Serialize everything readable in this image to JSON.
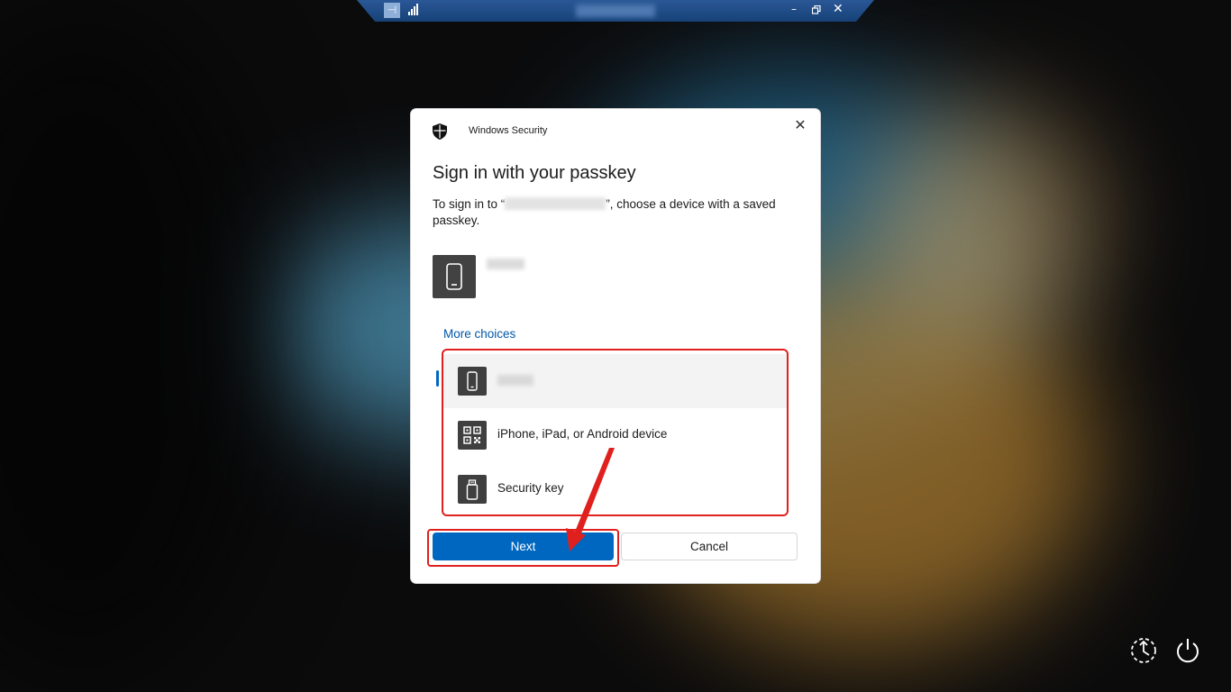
{
  "remote_bar": {
    "pin_icon": "pin-icon",
    "signal_icon": "signal-bars-icon",
    "controls": [
      "minimize-icon",
      "restore-icon",
      "close-icon"
    ]
  },
  "dialog": {
    "app_name": "Windows Security",
    "title": "Sign in with your passkey",
    "description_before": "To sign in to “",
    "description_after": "”, choose a device with a saved passkey.",
    "more_choices": "More choices",
    "choices": [
      {
        "label": "",
        "icon": "phone-icon",
        "selected": true
      },
      {
        "label": "iPhone, iPad, or Android device",
        "icon": "qr-code-icon",
        "selected": false
      },
      {
        "label": "Security key",
        "icon": "usb-key-icon",
        "selected": false
      }
    ],
    "next_label": "Next",
    "cancel_label": "Cancel"
  },
  "colors": {
    "accent": "#0067c0",
    "annotation": "#e0201e",
    "link": "#0057a8"
  },
  "bottom_icons": [
    "accessibility-icon",
    "power-icon"
  ]
}
